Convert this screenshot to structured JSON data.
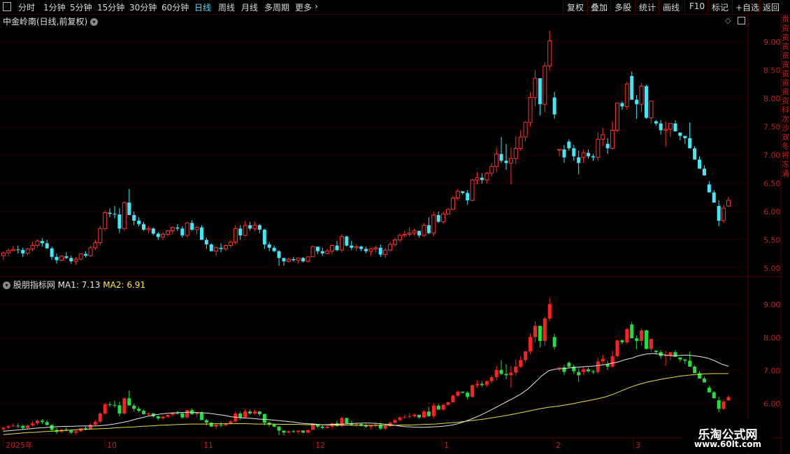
{
  "toolbar": {
    "left_items": [
      "分时",
      "1分钟",
      "5分钟",
      "15分钟",
      "30分钟",
      "60分钟",
      "日线",
      "周线",
      "月线",
      "多周期",
      "更多"
    ],
    "active": "日线",
    "right_items": [
      "复权",
      "叠加",
      "多股",
      "统计",
      "画线",
      "F10",
      "标记",
      "+自选",
      "返回"
    ]
  },
  "main_panel": {
    "title": "中金岭南(日线,前复权)"
  },
  "sub_panel": {
    "title": "股朋指标网",
    "ma1_label": "MA1: 7.13",
    "ma2_label": "MA2: 6.91"
  },
  "side_text": "贵资资资资资资资资资科次沙双冬将冻涌",
  "x_axis": {
    "labels": [
      "2025年",
      "10",
      "11",
      "12",
      "1",
      "2",
      "3"
    ]
  },
  "watermark": {
    "line1": "乐淘公式网",
    "line2": "www.60lt.com"
  },
  "colors": {
    "up": "#ff3030",
    "down": "#40e8f8",
    "sub_up": "#ff2020",
    "sub_down": "#20e040",
    "ma1": "#e8e8e8",
    "ma2": "#e8e040",
    "grid": "#5a0000"
  },
  "chart_data": [
    {
      "type": "candlestick",
      "title": "中金岭南(日线,前复权)",
      "y_ticks": [
        9.0,
        8.5,
        8.0,
        7.5,
        7.0,
        6.5,
        6.0,
        5.5,
        5.0
      ],
      "ylim": [
        4.9,
        9.25
      ],
      "candles_ohlc": [
        [
          5.22,
          5.3,
          5.14,
          5.27
        ],
        [
          5.27,
          5.35,
          5.22,
          5.31
        ],
        [
          5.31,
          5.4,
          5.3,
          5.33
        ],
        [
          5.33,
          5.4,
          5.26,
          5.32
        ],
        [
          5.32,
          5.36,
          5.2,
          5.26
        ],
        [
          5.26,
          5.36,
          5.23,
          5.34
        ],
        [
          5.34,
          5.46,
          5.3,
          5.4
        ],
        [
          5.4,
          5.51,
          5.36,
          5.48
        ],
        [
          5.48,
          5.53,
          5.38,
          5.44
        ],
        [
          5.44,
          5.5,
          5.34,
          5.35
        ],
        [
          5.35,
          5.38,
          5.15,
          5.2
        ],
        [
          5.2,
          5.26,
          5.08,
          5.14
        ],
        [
          5.14,
          5.23,
          5.12,
          5.21
        ],
        [
          5.21,
          5.28,
          5.16,
          5.18
        ],
        [
          5.18,
          5.22,
          5.08,
          5.12
        ],
        [
          5.12,
          5.2,
          5.06,
          5.16
        ],
        [
          5.16,
          5.26,
          5.14,
          5.25
        ],
        [
          5.25,
          5.3,
          5.19,
          5.22
        ],
        [
          5.22,
          5.4,
          5.2,
          5.36
        ],
        [
          5.36,
          5.5,
          5.32,
          5.45
        ],
        [
          5.45,
          5.75,
          5.4,
          5.7
        ],
        [
          5.7,
          6.02,
          5.66,
          5.98
        ],
        [
          5.98,
          6.06,
          5.9,
          5.96
        ],
        [
          5.96,
          6.1,
          5.88,
          5.95
        ],
        [
          5.95,
          6.06,
          5.62,
          5.7
        ],
        [
          5.7,
          6.18,
          5.66,
          6.16
        ],
        [
          6.16,
          6.4,
          5.98,
          5.94
        ],
        [
          5.94,
          6.0,
          5.76,
          5.84
        ],
        [
          5.84,
          5.9,
          5.74,
          5.78
        ],
        [
          5.78,
          5.82,
          5.66,
          5.68
        ],
        [
          5.68,
          5.74,
          5.62,
          5.7
        ],
        [
          5.7,
          5.72,
          5.58,
          5.61
        ],
        [
          5.61,
          5.64,
          5.5,
          5.55
        ],
        [
          5.55,
          5.64,
          5.5,
          5.6
        ],
        [
          5.6,
          5.68,
          5.56,
          5.66
        ],
        [
          5.66,
          5.74,
          5.6,
          5.72
        ],
        [
          5.72,
          5.78,
          5.66,
          5.7
        ],
        [
          5.7,
          5.74,
          5.54,
          5.58
        ],
        [
          5.58,
          5.82,
          5.54,
          5.8
        ],
        [
          5.8,
          5.85,
          5.66,
          5.68
        ],
        [
          5.68,
          5.74,
          5.6,
          5.72
        ],
        [
          5.72,
          5.76,
          5.5,
          5.5
        ],
        [
          5.5,
          5.54,
          5.34,
          5.42
        ],
        [
          5.42,
          5.44,
          5.3,
          5.3
        ],
        [
          5.3,
          5.38,
          5.22,
          5.36
        ],
        [
          5.36,
          5.44,
          5.28,
          5.34
        ],
        [
          5.34,
          5.42,
          5.3,
          5.4
        ],
        [
          5.4,
          5.5,
          5.36,
          5.46
        ],
        [
          5.46,
          5.76,
          5.42,
          5.7
        ],
        [
          5.7,
          5.76,
          5.5,
          5.58
        ],
        [
          5.58,
          5.84,
          5.56,
          5.76
        ],
        [
          5.76,
          5.82,
          5.66,
          5.7
        ],
        [
          5.7,
          5.82,
          5.66,
          5.76
        ],
        [
          5.76,
          5.78,
          5.62,
          5.68
        ],
        [
          5.68,
          5.7,
          5.34,
          5.42
        ],
        [
          5.42,
          5.46,
          5.3,
          5.36
        ],
        [
          5.36,
          5.4,
          5.28,
          5.3
        ],
        [
          5.3,
          5.32,
          5.04,
          5.18
        ],
        [
          5.18,
          5.12,
          5.04,
          5.12
        ],
        [
          5.12,
          5.18,
          5.1,
          5.16
        ],
        [
          5.16,
          5.2,
          5.12,
          5.14
        ],
        [
          5.14,
          5.18,
          5.08,
          5.18
        ],
        [
          5.18,
          5.2,
          5.1,
          5.12
        ],
        [
          5.12,
          5.2,
          5.1,
          5.2
        ],
        [
          5.2,
          5.4,
          5.22,
          5.38
        ],
        [
          5.38,
          5.32,
          5.25,
          5.3
        ],
        [
          5.3,
          5.36,
          5.22,
          5.26
        ],
        [
          5.26,
          5.34,
          5.24,
          5.3
        ],
        [
          5.3,
          5.42,
          5.24,
          5.4
        ],
        [
          5.4,
          5.48,
          5.3,
          5.32
        ],
        [
          5.32,
          5.6,
          5.28,
          5.56
        ],
        [
          5.56,
          5.58,
          5.38,
          5.4
        ],
        [
          5.4,
          5.48,
          5.32,
          5.36
        ],
        [
          5.36,
          5.42,
          5.3,
          5.38
        ],
        [
          5.38,
          5.4,
          5.3,
          5.34
        ],
        [
          5.34,
          5.38,
          5.26,
          5.3
        ],
        [
          5.3,
          5.36,
          5.22,
          5.34
        ],
        [
          5.34,
          5.4,
          5.28,
          5.36
        ],
        [
          5.36,
          5.42,
          5.2,
          5.24
        ],
        [
          5.24,
          5.36,
          5.18,
          5.32
        ],
        [
          5.32,
          5.46,
          5.3,
          5.42
        ],
        [
          5.42,
          5.54,
          5.38,
          5.5
        ],
        [
          5.5,
          5.62,
          5.46,
          5.58
        ],
        [
          5.58,
          5.66,
          5.54,
          5.6
        ],
        [
          5.6,
          5.72,
          5.56,
          5.62
        ],
        [
          5.62,
          5.7,
          5.58,
          5.66
        ],
        [
          5.66,
          5.58,
          5.54,
          5.58
        ],
        [
          5.58,
          5.8,
          5.56,
          5.76
        ],
        [
          5.76,
          5.9,
          5.6,
          5.62
        ],
        [
          5.62,
          6.0,
          5.56,
          5.94
        ],
        [
          5.94,
          6.0,
          5.8,
          5.82
        ],
        [
          5.82,
          6.0,
          5.78,
          5.96
        ],
        [
          5.96,
          6.06,
          5.94,
          6.04
        ],
        [
          6.04,
          6.28,
          6.02,
          6.24
        ],
        [
          6.24,
          6.4,
          6.2,
          6.36
        ],
        [
          6.36,
          6.36,
          6.3,
          6.33
        ],
        [
          6.33,
          6.38,
          6.12,
          6.2
        ],
        [
          6.2,
          6.58,
          6.18,
          6.56
        ],
        [
          6.56,
          6.7,
          6.48,
          6.6
        ],
        [
          6.6,
          6.68,
          6.5,
          6.56
        ],
        [
          6.56,
          6.7,
          6.5,
          6.68
        ],
        [
          6.68,
          6.86,
          6.62,
          6.8
        ],
        [
          6.8,
          7.14,
          6.7,
          7.02
        ],
        [
          7.02,
          7.32,
          6.86,
          6.9
        ],
        [
          6.9,
          7.2,
          6.74,
          6.86
        ],
        [
          6.86,
          7.14,
          6.48,
          6.94
        ],
        [
          6.94,
          7.34,
          6.84,
          7.12
        ],
        [
          7.12,
          7.44,
          7.08,
          7.32
        ],
        [
          7.32,
          7.6,
          7.24,
          7.58
        ],
        [
          7.58,
          8.12,
          7.5,
          8.02
        ],
        [
          8.02,
          8.5,
          7.86,
          8.36
        ],
        [
          8.36,
          8.12,
          7.7,
          7.9
        ],
        [
          7.9,
          8.64,
          7.76,
          8.58
        ],
        [
          8.58,
          9.2,
          8.5,
          9.02
        ],
        [
          8.02,
          8.12,
          7.64,
          7.72
        ],
        [
          7.1,
          7.1,
          6.98,
          7.1
        ],
        [
          7.1,
          7.18,
          6.86,
          6.96
        ],
        [
          7.24,
          7.28,
          7.08,
          7.12
        ],
        [
          7.12,
          7.18,
          6.9,
          6.98
        ],
        [
          6.96,
          7.08,
          6.66,
          6.86
        ],
        [
          6.96,
          7.1,
          6.86,
          7.04
        ],
        [
          7.04,
          7.1,
          6.94,
          6.98
        ],
        [
          6.98,
          7.02,
          6.9,
          6.96
        ],
        [
          6.96,
          7.4,
          6.9,
          7.28
        ],
        [
          7.28,
          7.48,
          7.16,
          7.36
        ],
        [
          7.2,
          7.3,
          7.02,
          7.12
        ],
        [
          7.12,
          7.6,
          7.1,
          7.44
        ],
        [
          7.44,
          7.92,
          7.4,
          7.92
        ],
        [
          7.92,
          7.95,
          7.8,
          7.86
        ],
        [
          7.86,
          8.3,
          7.8,
          8.26
        ],
        [
          8.4,
          8.48,
          7.98,
          7.98
        ],
        [
          7.98,
          8.06,
          7.64,
          7.9
        ],
        [
          7.9,
          8.28,
          7.76,
          8.22
        ],
        [
          8.22,
          8.24,
          7.64,
          7.66
        ],
        [
          7.66,
          7.96,
          7.56,
          7.96
        ],
        [
          7.6,
          7.62,
          7.52,
          7.56
        ],
        [
          7.56,
          7.62,
          7.36,
          7.44
        ],
        [
          7.44,
          7.6,
          7.14,
          7.46
        ],
        [
          7.46,
          7.56,
          7.32,
          7.56
        ],
        [
          7.56,
          7.62,
          7.42,
          7.42
        ],
        [
          7.4,
          7.38,
          7.26,
          7.34
        ],
        [
          7.34,
          7.34,
          7.2,
          7.3
        ],
        [
          7.3,
          7.58,
          7.14,
          7.12
        ],
        [
          7.12,
          7.16,
          6.98,
          6.92
        ],
        [
          6.92,
          6.98,
          6.76,
          6.76
        ],
        [
          6.76,
          6.82,
          6.64,
          6.64
        ],
        [
          6.48,
          6.54,
          6.34,
          6.34
        ],
        [
          6.34,
          6.38,
          6.16,
          6.16
        ],
        [
          6.1,
          6.2,
          5.74,
          5.84
        ],
        [
          5.84,
          6.12,
          5.8,
          6.06
        ],
        [
          6.1,
          6.26,
          6.08,
          6.2
        ]
      ]
    },
    {
      "type": "candlestick",
      "title": "股朋指标网",
      "y_ticks": [
        9.0,
        8.0,
        7.0,
        6.0
      ],
      "series": [
        {
          "name": "MA1",
          "last": 7.13
        },
        {
          "name": "MA2",
          "last": 6.91
        }
      ],
      "ma1": [
        5.16,
        5.18,
        5.2,
        5.22,
        5.24,
        5.26,
        5.27,
        5.29,
        5.3,
        5.31,
        5.31,
        5.32,
        5.32,
        5.32,
        5.33,
        5.35,
        5.38,
        5.42,
        5.46,
        5.52,
        5.57,
        5.62,
        5.66,
        5.69,
        5.71,
        5.72,
        5.73,
        5.74,
        5.73,
        5.72,
        5.7,
        5.67,
        5.64,
        5.6,
        5.58,
        5.56,
        5.55,
        5.53,
        5.52,
        5.5,
        5.48,
        5.46,
        5.44,
        5.41,
        5.39,
        5.38,
        5.36,
        5.36,
        5.37,
        5.38,
        5.39,
        5.4,
        5.41,
        5.41,
        5.4,
        5.38,
        5.36,
        5.33,
        5.3,
        5.29,
        5.28,
        5.28,
        5.29,
        5.3,
        5.32,
        5.35,
        5.4,
        5.47,
        5.55,
        5.64,
        5.74,
        5.85,
        5.96,
        6.07,
        6.18,
        6.3,
        6.45,
        6.65,
        6.85,
        7.0,
        7.05,
        7.06,
        7.08,
        7.1,
        7.12,
        7.13,
        7.15,
        7.18,
        7.22,
        7.26,
        7.33,
        7.38,
        7.45,
        7.5,
        7.52,
        7.5,
        7.47,
        7.45,
        7.46,
        7.47,
        7.45,
        7.42,
        7.38,
        7.3,
        7.2,
        7.13
      ],
      "ma2": [
        5.06,
        5.08,
        5.1,
        5.12,
        5.13,
        5.15,
        5.16,
        5.18,
        5.19,
        5.21,
        5.22,
        5.23,
        5.24,
        5.25,
        5.27,
        5.28,
        5.29,
        5.31,
        5.32,
        5.34,
        5.35,
        5.36,
        5.37,
        5.38,
        5.38,
        5.38,
        5.39,
        5.39,
        5.39,
        5.39,
        5.39,
        5.38,
        5.38,
        5.38,
        5.37,
        5.37,
        5.37,
        5.36,
        5.36,
        5.36,
        5.35,
        5.35,
        5.35,
        5.34,
        5.34,
        5.34,
        5.34,
        5.34,
        5.34,
        5.35,
        5.35,
        5.36,
        5.37,
        5.38,
        5.4,
        5.42,
        5.44,
        5.47,
        5.5,
        5.53,
        5.57,
        5.61,
        5.65,
        5.7,
        5.75,
        5.8,
        5.85,
        5.89,
        5.92,
        5.96,
        6.0,
        6.05,
        6.1,
        6.15,
        6.21,
        6.3,
        6.4,
        6.5,
        6.58,
        6.65,
        6.7,
        6.75,
        6.79,
        6.83,
        6.86,
        6.88,
        6.9,
        6.91,
        6.91,
        6.91
      ]
    }
  ]
}
